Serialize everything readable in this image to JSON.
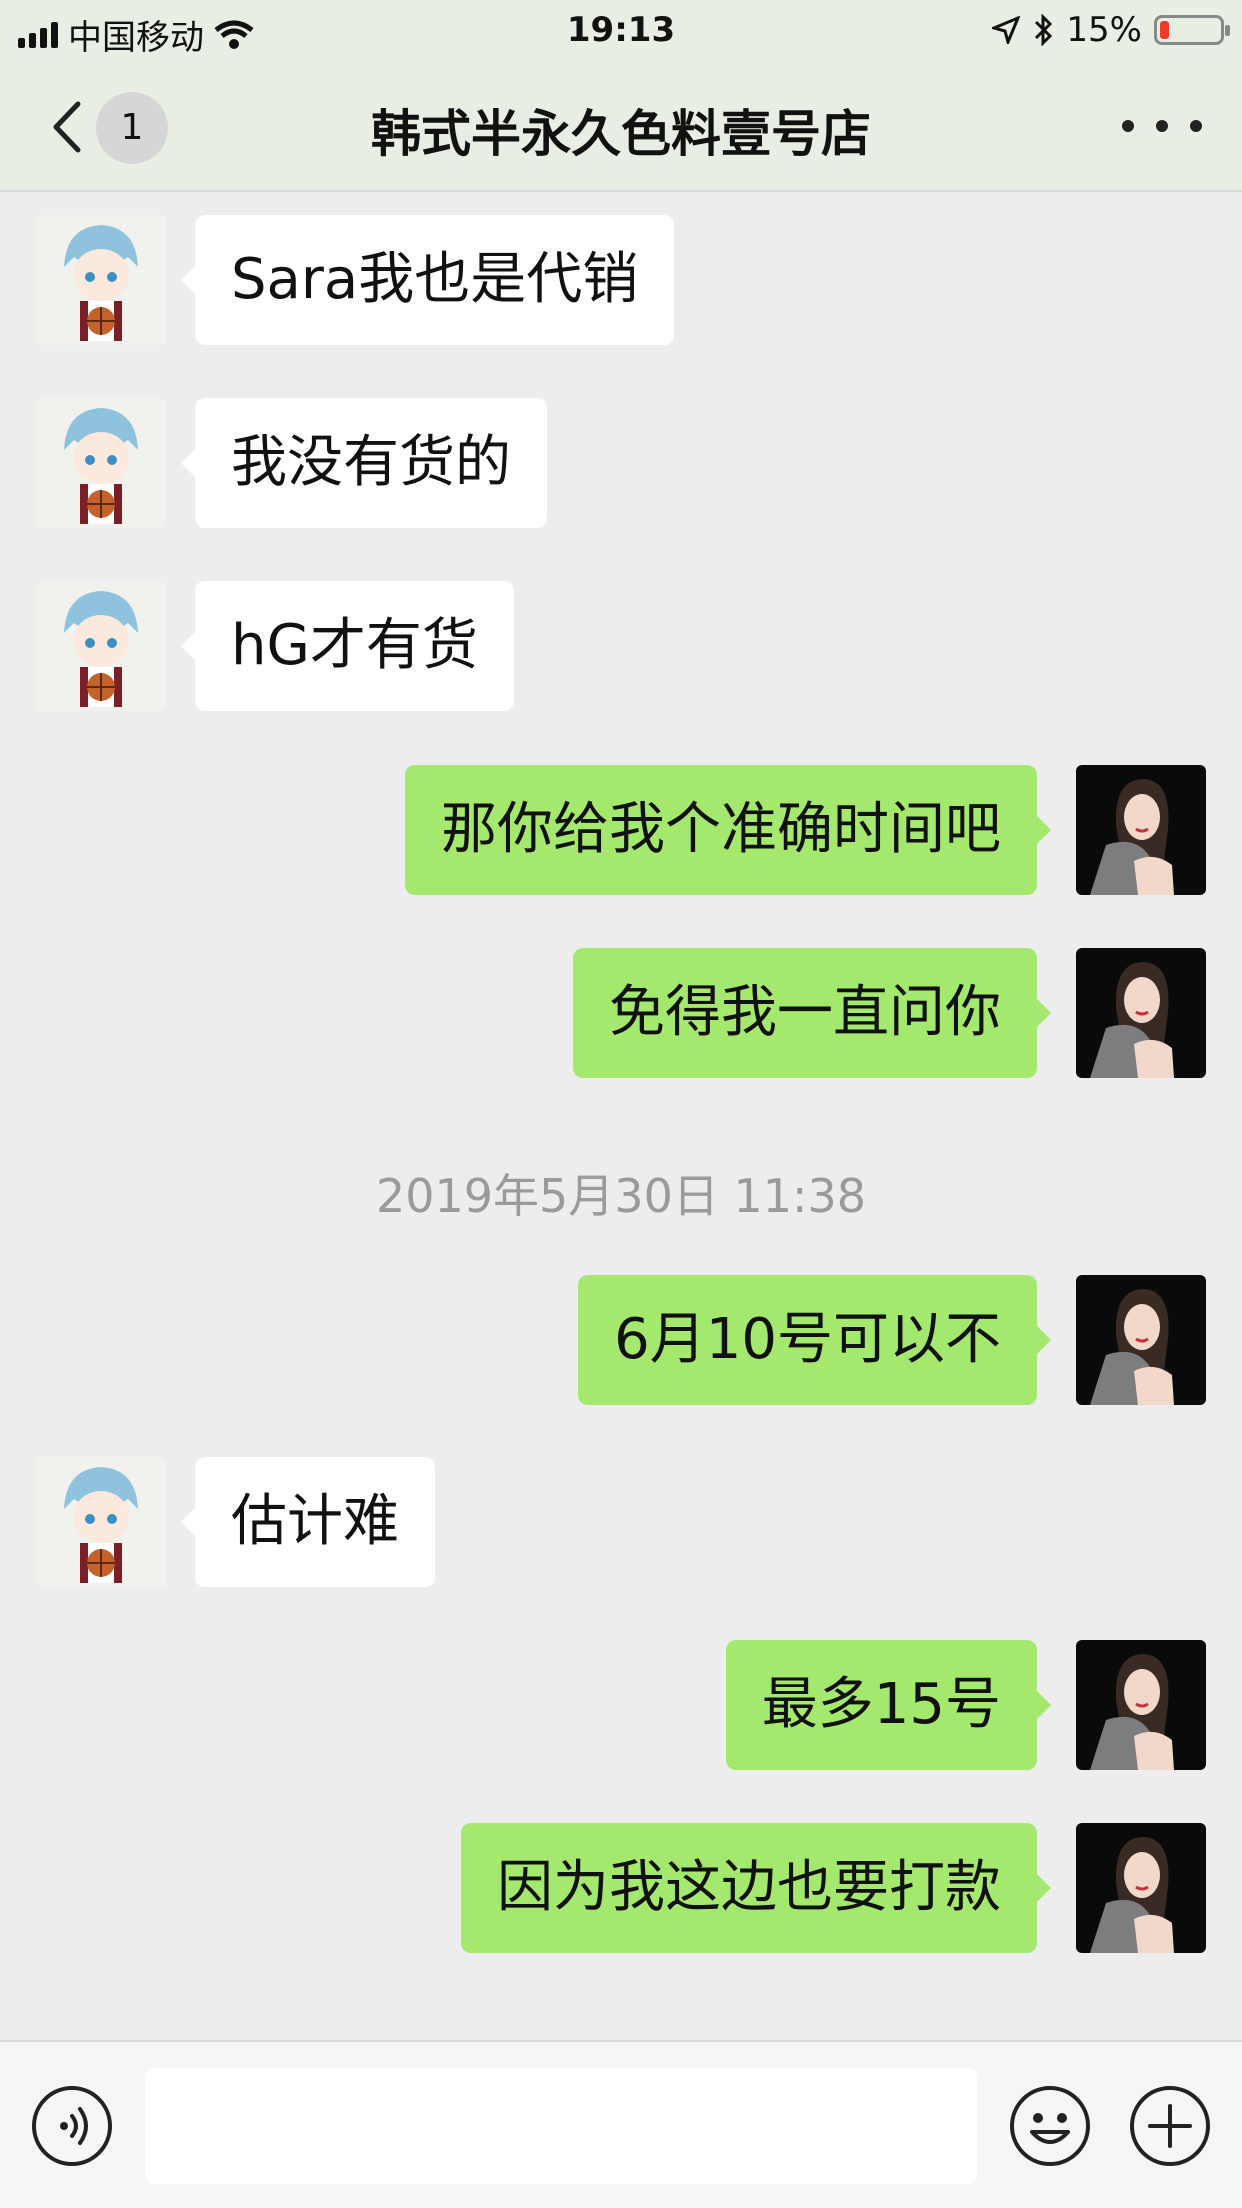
{
  "status_bar": {
    "carrier": "中国移动",
    "time": "19:13",
    "battery_percent": "15%",
    "battery_level": 0.15,
    "battery_color": "#f03a2e"
  },
  "nav": {
    "unread_badge": "1",
    "title": "韩式半永久色料壹号店"
  },
  "messages": [
    {
      "side": "in",
      "text": "Sara我也是代销"
    },
    {
      "side": "in",
      "text": "我没有货的"
    },
    {
      "side": "in",
      "text": "hG才有货"
    },
    {
      "side": "out",
      "text": "那你给我个准确时间吧"
    },
    {
      "side": "out",
      "text": "免得我一直问你"
    },
    {
      "side": "out",
      "text": "6月10号可以不"
    },
    {
      "side": "in",
      "text": "估计难"
    },
    {
      "side": "out",
      "text": "最多15号"
    },
    {
      "side": "out",
      "text": "因为我这边也要打款"
    }
  ],
  "timestamp": "2019年5月30日 11:38",
  "colors": {
    "outgoing_bubble": "#a4e86d",
    "incoming_bubble": "#ffffff",
    "chat_background": "#ededed"
  },
  "icons": {
    "voice": "voice-icon",
    "emoji": "emoji-icon",
    "plus": "plus-icon",
    "back": "back-icon",
    "more": "more-icon"
  }
}
